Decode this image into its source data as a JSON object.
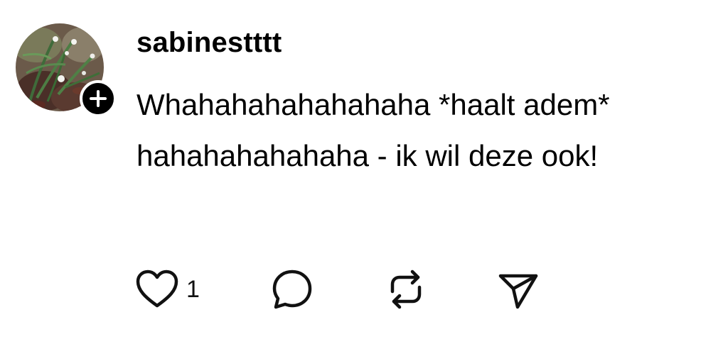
{
  "post": {
    "username": "sabinestttt",
    "text_line1": "Whahahahahahahaha *haalt adem*",
    "text_line2": "hahahahahahaha - ik wil deze ook!"
  },
  "actions": {
    "like_count": "1",
    "like_icon": "heart-icon",
    "reply_icon": "speech-bubble-icon",
    "repost_icon": "repost-arrows-icon",
    "share_icon": "paper-plane-icon"
  },
  "avatar": {
    "badge_icon": "plus-icon"
  }
}
